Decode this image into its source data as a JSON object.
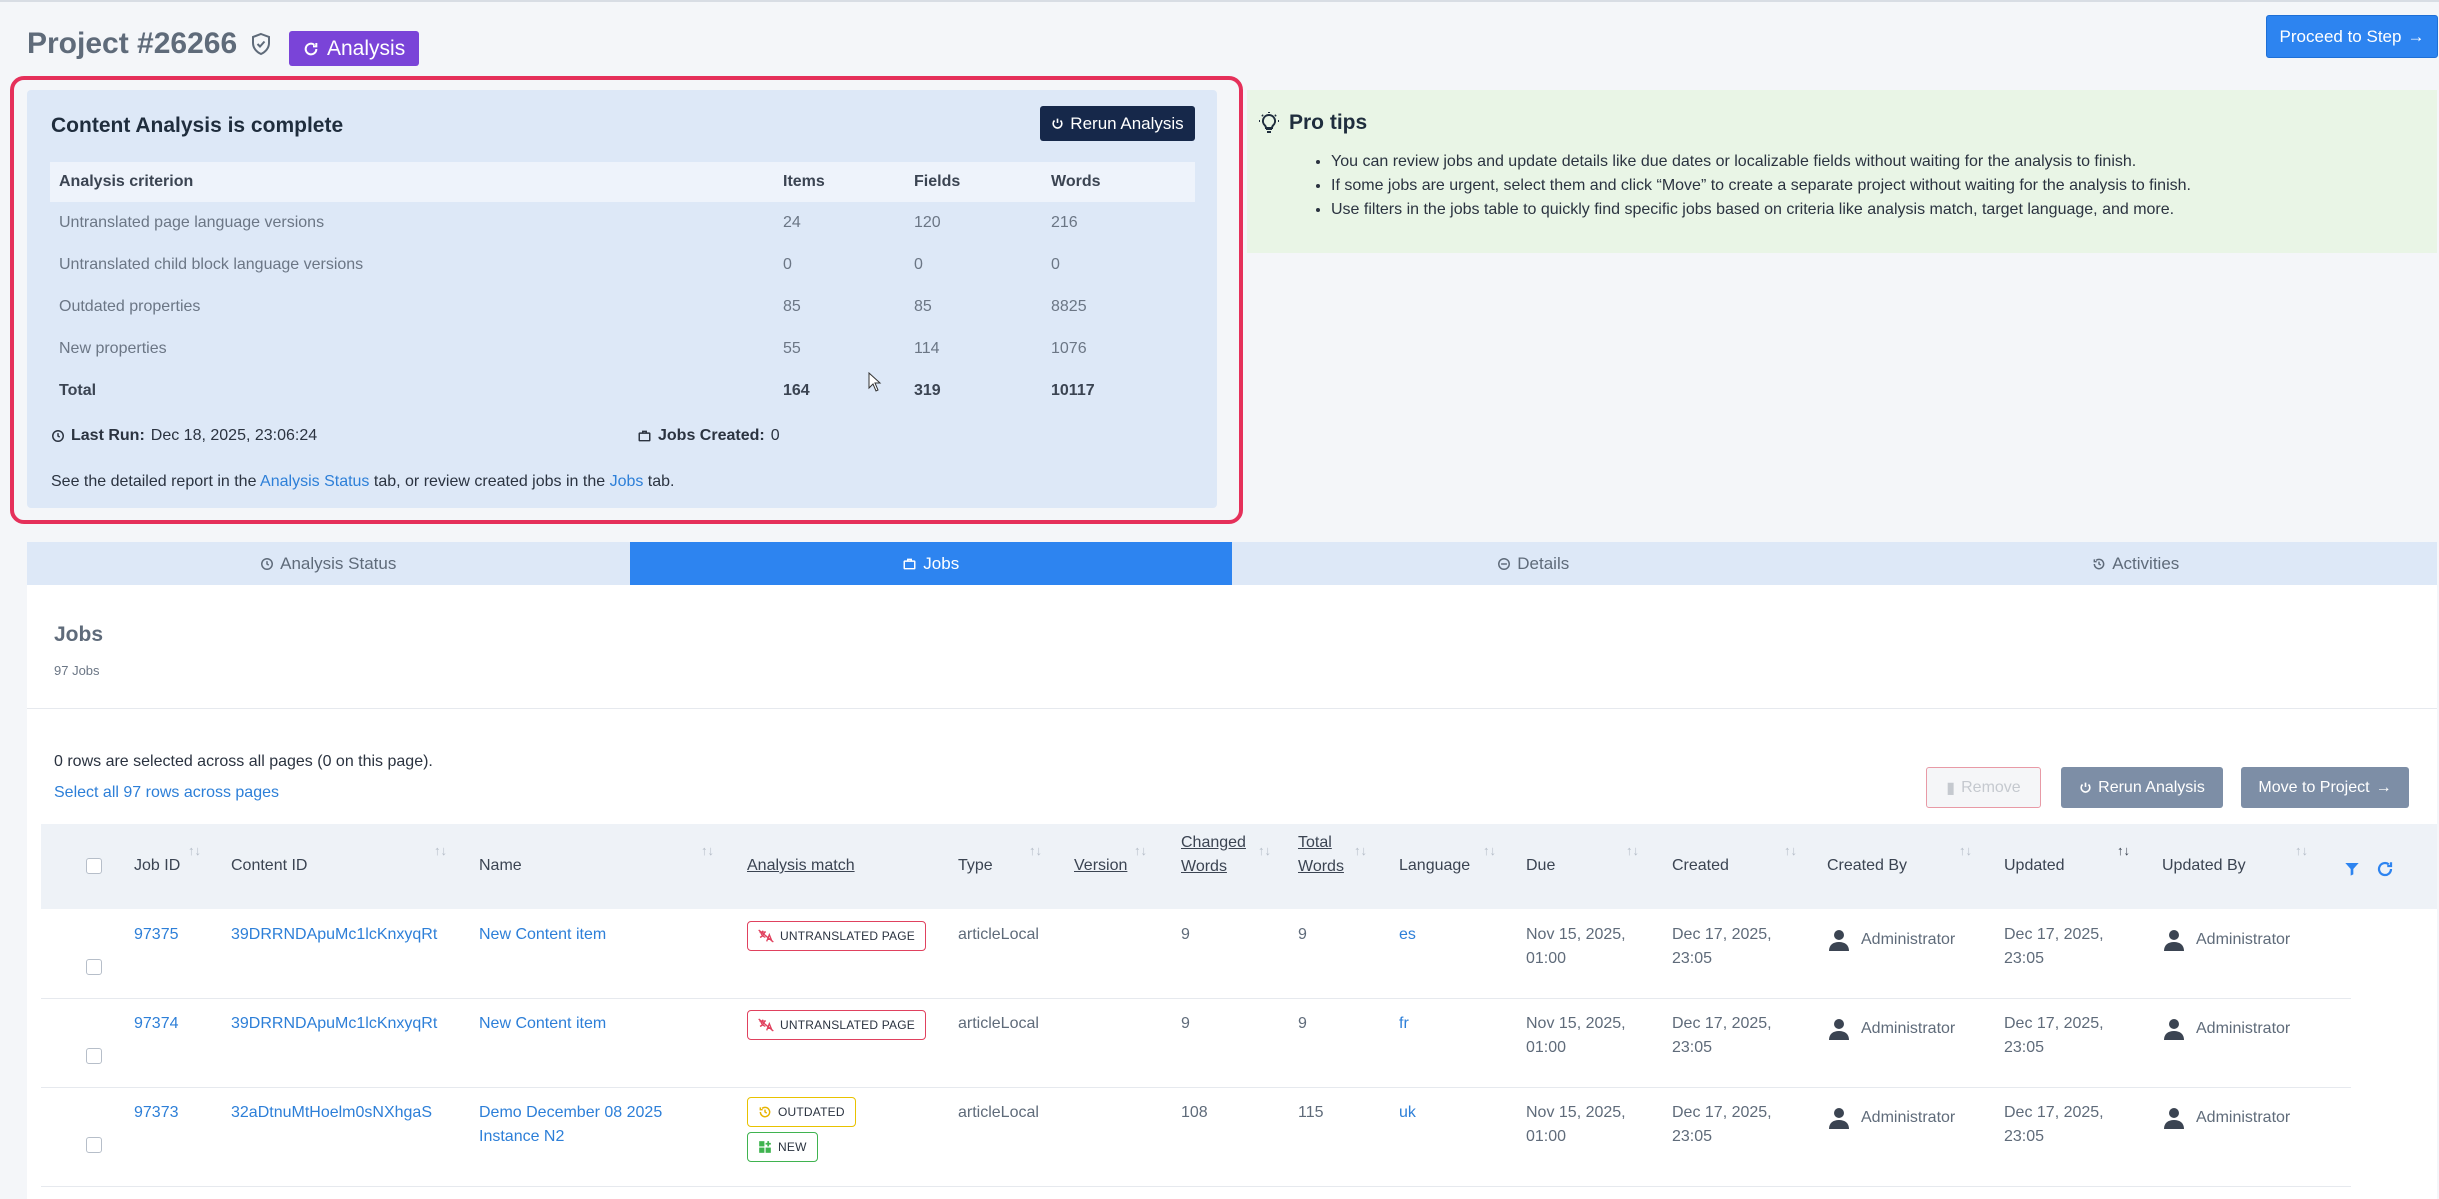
{
  "header": {
    "project_title": "Project #26266",
    "status_badge": "Analysis",
    "proceed_label": "Proceed to Step"
  },
  "analysis_card": {
    "title": "Content Analysis is complete",
    "rerun_label": "Rerun Analysis",
    "columns": [
      "Analysis criterion",
      "Items",
      "Fields",
      "Words"
    ],
    "rows": [
      [
        "Untranslated page language versions",
        "24",
        "120",
        "216"
      ],
      [
        "Untranslated child block language versions",
        "0",
        "0",
        "0"
      ],
      [
        "Outdated properties",
        "85",
        "85",
        "8825"
      ],
      [
        "New properties",
        "55",
        "114",
        "1076"
      ],
      [
        "Total",
        "164",
        "319",
        "10117"
      ]
    ],
    "last_run_label": "Last Run:",
    "last_run_value": "Dec 18, 2025, 23:06:24",
    "jobs_created_label": "Jobs Created:",
    "jobs_created_value": "0",
    "footer_pre": "See the detailed report in the ",
    "footer_link1": "Analysis Status",
    "footer_mid": " tab, or review created jobs in the ",
    "footer_link2": "Jobs",
    "footer_post": " tab."
  },
  "pro_tips": {
    "title": "Pro tips",
    "items": [
      "You can review jobs and update details like due dates or localizable fields without waiting for the analysis to finish.",
      "If some jobs are urgent, select them and click “Move” to create a separate project without waiting for the analysis to finish.",
      "Use filters in the jobs table to quickly find specific jobs based on criteria like analysis match, target language, and more."
    ]
  },
  "tabs": [
    {
      "label": "Analysis Status",
      "icon": "clock-icon"
    },
    {
      "label": "Jobs",
      "icon": "briefcase-icon",
      "active": true
    },
    {
      "label": "Details",
      "icon": "minus-circle-icon"
    },
    {
      "label": "Activities",
      "icon": "history-icon"
    }
  ],
  "jobs": {
    "title": "Jobs",
    "count": "97 Jobs",
    "selection_text": "0 rows are selected across all pages (0 on this page).",
    "select_all_label": "Select all 97 rows across pages",
    "remove_label": "Remove",
    "rerun_label": "Rerun Analysis",
    "move_label": "Move to Project",
    "headers": {
      "job_id": "Job ID",
      "content_id": "Content ID",
      "name": "Name",
      "analysis_match": "Analysis match",
      "type": "Type",
      "version": "Version",
      "changed_words_1": "Changed",
      "changed_words_2": "Words",
      "total_words_1": "Total",
      "total_words_2": "Words",
      "language": "Language",
      "due": "Due",
      "created": "Created",
      "created_by": "Created By",
      "updated": "Updated",
      "updated_by": "Updated By"
    },
    "rows": [
      {
        "job_id": "97375",
        "content_id": "39DRRNDApuMc1lcKnxyqRt",
        "name_1": "New Content item",
        "name_2": "",
        "tag1": "UNTRANSLATED PAGE",
        "tag2": "",
        "type": "articleLocal",
        "changed": "9",
        "total": "9",
        "language": "es",
        "due_1": "Nov 15, 2025,",
        "due_2": "01:00",
        "created_1": "Dec 17, 2025,",
        "created_2": "23:05",
        "created_by": "Administrator",
        "updated_1": "Dec 17, 2025,",
        "updated_2": "23:05",
        "updated_by": "Administrator"
      },
      {
        "job_id": "97374",
        "content_id": "39DRRNDApuMc1lcKnxyqRt",
        "name_1": "New Content item",
        "name_2": "",
        "tag1": "UNTRANSLATED PAGE",
        "tag2": "",
        "type": "articleLocal",
        "changed": "9",
        "total": "9",
        "language": "fr",
        "due_1": "Nov 15, 2025,",
        "due_2": "01:00",
        "created_1": "Dec 17, 2025,",
        "created_2": "23:05",
        "created_by": "Administrator",
        "updated_1": "Dec 17, 2025,",
        "updated_2": "23:05",
        "updated_by": "Administrator"
      },
      {
        "job_id": "97373",
        "content_id": "32aDtnuMtHoelm0sNXhgaS",
        "name_1": "Demo December 08 2025",
        "name_2": "Instance N2",
        "tag1": "OUTDATED",
        "tag2": "NEW",
        "type": "articleLocal",
        "changed": "108",
        "total": "115",
        "language": "uk",
        "due_1": "Nov 15, 2025,",
        "due_2": "01:00",
        "created_1": "Dec 17, 2025,",
        "created_2": "23:05",
        "created_by": "Administrator",
        "updated_1": "Dec 17, 2025,",
        "updated_2": "23:05",
        "updated_by": "Administrator"
      }
    ]
  },
  "colors": {
    "accent": "#2d84f0",
    "analysis_badge": "#7a44d8",
    "highlight_frame": "#e5305a",
    "card_bg": "#dde8f7",
    "tips_bg": "#e9f5e6",
    "dark_button": "#16284a"
  }
}
